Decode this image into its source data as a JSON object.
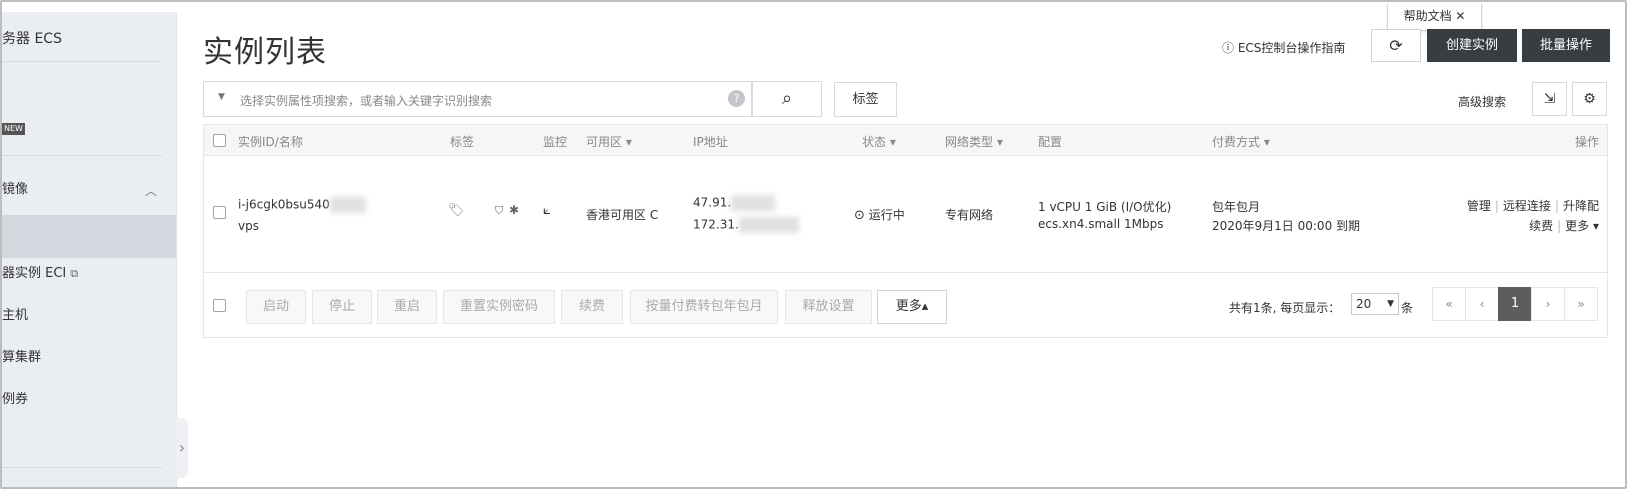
{
  "sidebar": {
    "title": "务器 ECS",
    "new_badge": "NEW",
    "items": [
      {
        "label": "镜像"
      },
      {
        "label": "器实例 ECI"
      },
      {
        "label": "主机"
      },
      {
        "label": "算集群"
      },
      {
        "label": "例券"
      }
    ]
  },
  "header": {
    "title": "实例列表",
    "help_tab": "帮助文档 ✕",
    "guide_link": "ECS控制台操作指南",
    "create_btn": "创建实例",
    "batch_btn": "批量操作"
  },
  "search": {
    "placeholder": "选择实例属性项搜索，或者输入关键字识别搜索",
    "tag_btn": "标签",
    "advanced": "高级搜索"
  },
  "table": {
    "columns": [
      "实例ID/名称",
      "标签",
      "监控",
      "可用区 ▾",
      "IP地址",
      "状态 ▾",
      "网络类型 ▾",
      "配置",
      "付费方式 ▾",
      "操作"
    ],
    "rows": [
      {
        "id": "i-j6cgk0bsu540",
        "name": "vps",
        "zone": "香港可用区 C",
        "ip_public": "47.91.",
        "ip_private": "172.31.",
        "status": "运行中",
        "network": "专有网络",
        "config_line1": "1 vCPU 1 GiB (I/O优化)",
        "config_line2": "ecs.xn4.small   1Mbps",
        "billing_line1": "包年包月",
        "billing_line2": "2020年9月1日 00:00 到期",
        "actions": {
          "manage": "管理",
          "remote": "远程连接",
          "upgrade": "升降配",
          "renew": "续费",
          "more": "更多 ▾"
        }
      }
    ]
  },
  "footer": {
    "buttons": [
      "启动",
      "停止",
      "重启",
      "重置实例密码",
      "续费",
      "按量付费转包年包月",
      "释放设置"
    ],
    "more_btn": "更多▴",
    "pager_info": "共有1条, 每页显示：",
    "page_size": "20",
    "page_unit": "条",
    "pages": [
      "«",
      "‹",
      "1",
      "›",
      "»"
    ]
  }
}
